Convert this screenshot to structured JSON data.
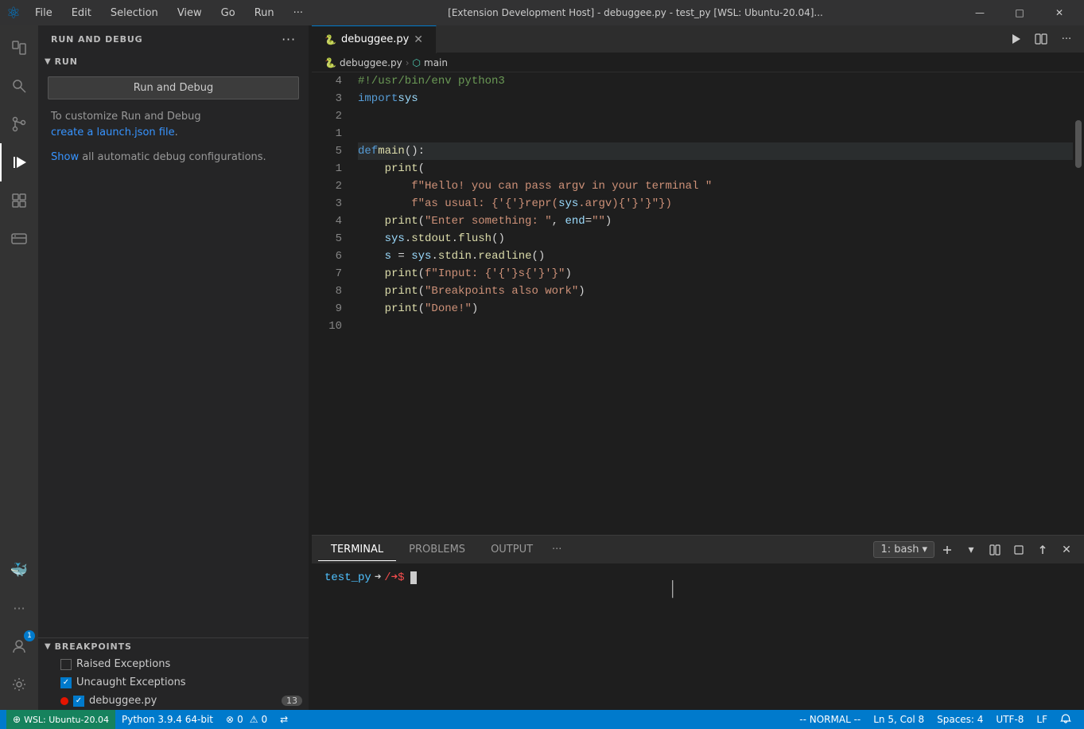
{
  "titlebar": {
    "logo": "⊕",
    "menu": [
      "File",
      "Edit",
      "Selection",
      "View",
      "Go",
      "Run",
      "···"
    ],
    "title": "[Extension Development Host] - debuggee.py - test_py [WSL: Ubuntu-20.04]...",
    "minimize": "—",
    "maximize": "□",
    "close": "✕"
  },
  "activitybar": {
    "icons": [
      {
        "name": "explorer-icon",
        "symbol": "⧉",
        "active": false
      },
      {
        "name": "search-icon",
        "symbol": "🔍",
        "active": false
      },
      {
        "name": "source-control-icon",
        "symbol": "⑂",
        "active": false
      },
      {
        "name": "debug-icon",
        "symbol": "▷",
        "active": true
      },
      {
        "name": "extensions-icon",
        "symbol": "⊞",
        "active": false
      },
      {
        "name": "remote-icon",
        "symbol": "🖥",
        "active": false
      }
    ],
    "bottom_icons": [
      {
        "name": "docker-icon",
        "symbol": "🐳"
      },
      {
        "name": "dots-icon",
        "symbol": "···"
      },
      {
        "name": "accounts-icon",
        "symbol": "👤",
        "badge": "1"
      },
      {
        "name": "settings-icon",
        "symbol": "⚙"
      }
    ]
  },
  "sidebar": {
    "header": "RUN AND DEBUG",
    "run_button": "Run and Debug",
    "hint1": "To customize Run and Debug",
    "hint_link": "create a launch.json file",
    "hint_period": ".",
    "hint2_link": "Show",
    "hint2": " all automatic debug configurations.",
    "breakpoints_section": "BREAKPOINTS",
    "breakpoints": [
      {
        "id": "raised",
        "label": "Raised Exceptions",
        "checked": false,
        "has_dot": false
      },
      {
        "id": "uncaught",
        "label": "Uncaught Exceptions",
        "checked": true,
        "has_dot": false
      },
      {
        "id": "debuggee",
        "label": "debuggee.py",
        "checked": true,
        "has_dot": true,
        "count": "13"
      }
    ]
  },
  "editor": {
    "tab_label": "debuggee.py",
    "breadcrumb_file": "debuggee.py",
    "breadcrumb_symbol": "main",
    "code_lines": [
      {
        "num": "4",
        "content": "#!/usr/bin/env python3",
        "type": "shebang",
        "highlight": false
      },
      {
        "num": "3",
        "content": "import sys",
        "type": "import",
        "highlight": false
      },
      {
        "num": "2",
        "content": "",
        "type": "empty",
        "highlight": false
      },
      {
        "num": "1",
        "content": "",
        "type": "empty",
        "highlight": false
      },
      {
        "num": "5",
        "content": "def main():",
        "type": "def",
        "highlight": true
      },
      {
        "num": "1",
        "content": "    print(",
        "type": "code",
        "highlight": false
      },
      {
        "num": "2",
        "content": "        f\"Hello! you can pass argv in your terminal \"",
        "type": "fstring",
        "highlight": false
      },
      {
        "num": "3",
        "content": "        f\"as usual: {repr(sys.argv)}\")",
        "type": "fstring",
        "highlight": false
      },
      {
        "num": "4",
        "content": "    print(\"Enter something: \", end=\"\")",
        "type": "code",
        "highlight": false
      },
      {
        "num": "5",
        "content": "    sys.stdout.flush()",
        "type": "code",
        "highlight": false
      },
      {
        "num": "6",
        "content": "    s = sys.stdin.readline()",
        "type": "code",
        "highlight": false
      },
      {
        "num": "7",
        "content": "    print(f\"Input: {s}\")",
        "type": "code",
        "highlight": false
      },
      {
        "num": "8",
        "content": "    print(\"Breakpoints also work\")",
        "type": "code",
        "bp": true,
        "highlight": false
      },
      {
        "num": "9",
        "content": "    print(\"Done!\")",
        "type": "code",
        "highlight": false
      },
      {
        "num": "10",
        "content": "",
        "type": "empty",
        "highlight": false
      }
    ]
  },
  "terminal": {
    "tabs": [
      "TERMINAL",
      "PROBLEMS",
      "OUTPUT"
    ],
    "active_tab": "TERMINAL",
    "shell_label": "1: bash",
    "prompt": "test_py ➜/➜$ ",
    "prompt_dir": "test_py",
    "prompt_sym": "➜",
    "prompt_branch": "➜/➜$"
  },
  "statusbar": {
    "wsl": "⊕ WSL: Ubuntu-20.04",
    "python": "Python 3.9.4 64-bit",
    "errors": "⊗ 0",
    "warnings": "⚠ 0",
    "remote": "⇄",
    "vim_mode": "-- NORMAL --",
    "cursor_pos": "Ln 5, Col 8",
    "spaces": "Spaces: 4",
    "encoding": "UTF-8",
    "line_ending": "LF",
    "notification_icon": "🔔"
  }
}
